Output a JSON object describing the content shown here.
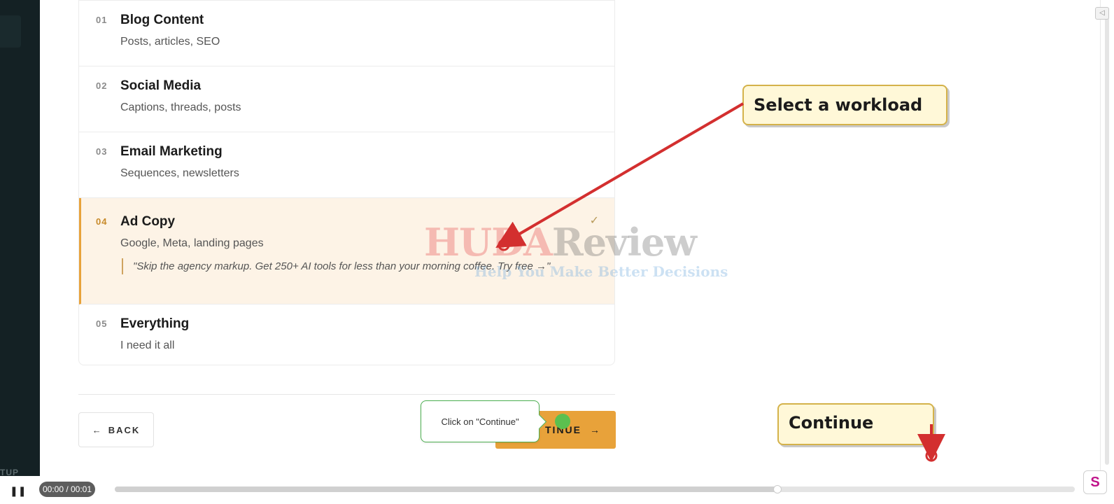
{
  "sidebar": {
    "setup_label": "TUP"
  },
  "options": [
    {
      "num": "01",
      "title": "Blog Content",
      "sub": "Posts, articles, SEO"
    },
    {
      "num": "02",
      "title": "Social Media",
      "sub": "Captions, threads, posts"
    },
    {
      "num": "03",
      "title": "Email Marketing",
      "sub": "Sequences, newsletters"
    },
    {
      "num": "04",
      "title": "Ad Copy",
      "sub": "Google, Meta, landing pages",
      "quote": "\"Skip the agency markup. Get 250+ AI tools for less than your morning coffee. Try free →\"",
      "check": "✓"
    },
    {
      "num": "05",
      "title": "Everything",
      "sub": "I need it all"
    }
  ],
  "buttons": {
    "back_label": "BACK",
    "back_icon": "←",
    "continue_label": "TINUE",
    "continue_icon": "→"
  },
  "hint": {
    "text": "Click on \"Continue\""
  },
  "callouts": {
    "workload": "Select a workload",
    "continue": "Continue"
  },
  "watermark": {
    "part_a": "HUDA",
    "part_b": "Review",
    "tagline": "Help You Make Better Decisions"
  },
  "player": {
    "play_icon": "❚❚",
    "time": "00:00 / 00:01",
    "progress": 0.69,
    "brand_icon": "S"
  },
  "colors": {
    "accent": "#e8a23a",
    "selected_bg": "#fdf3e6",
    "callout_bg": "#fff8d8",
    "arrow": "#d32f2f",
    "hint_green": "#5cc04f"
  }
}
